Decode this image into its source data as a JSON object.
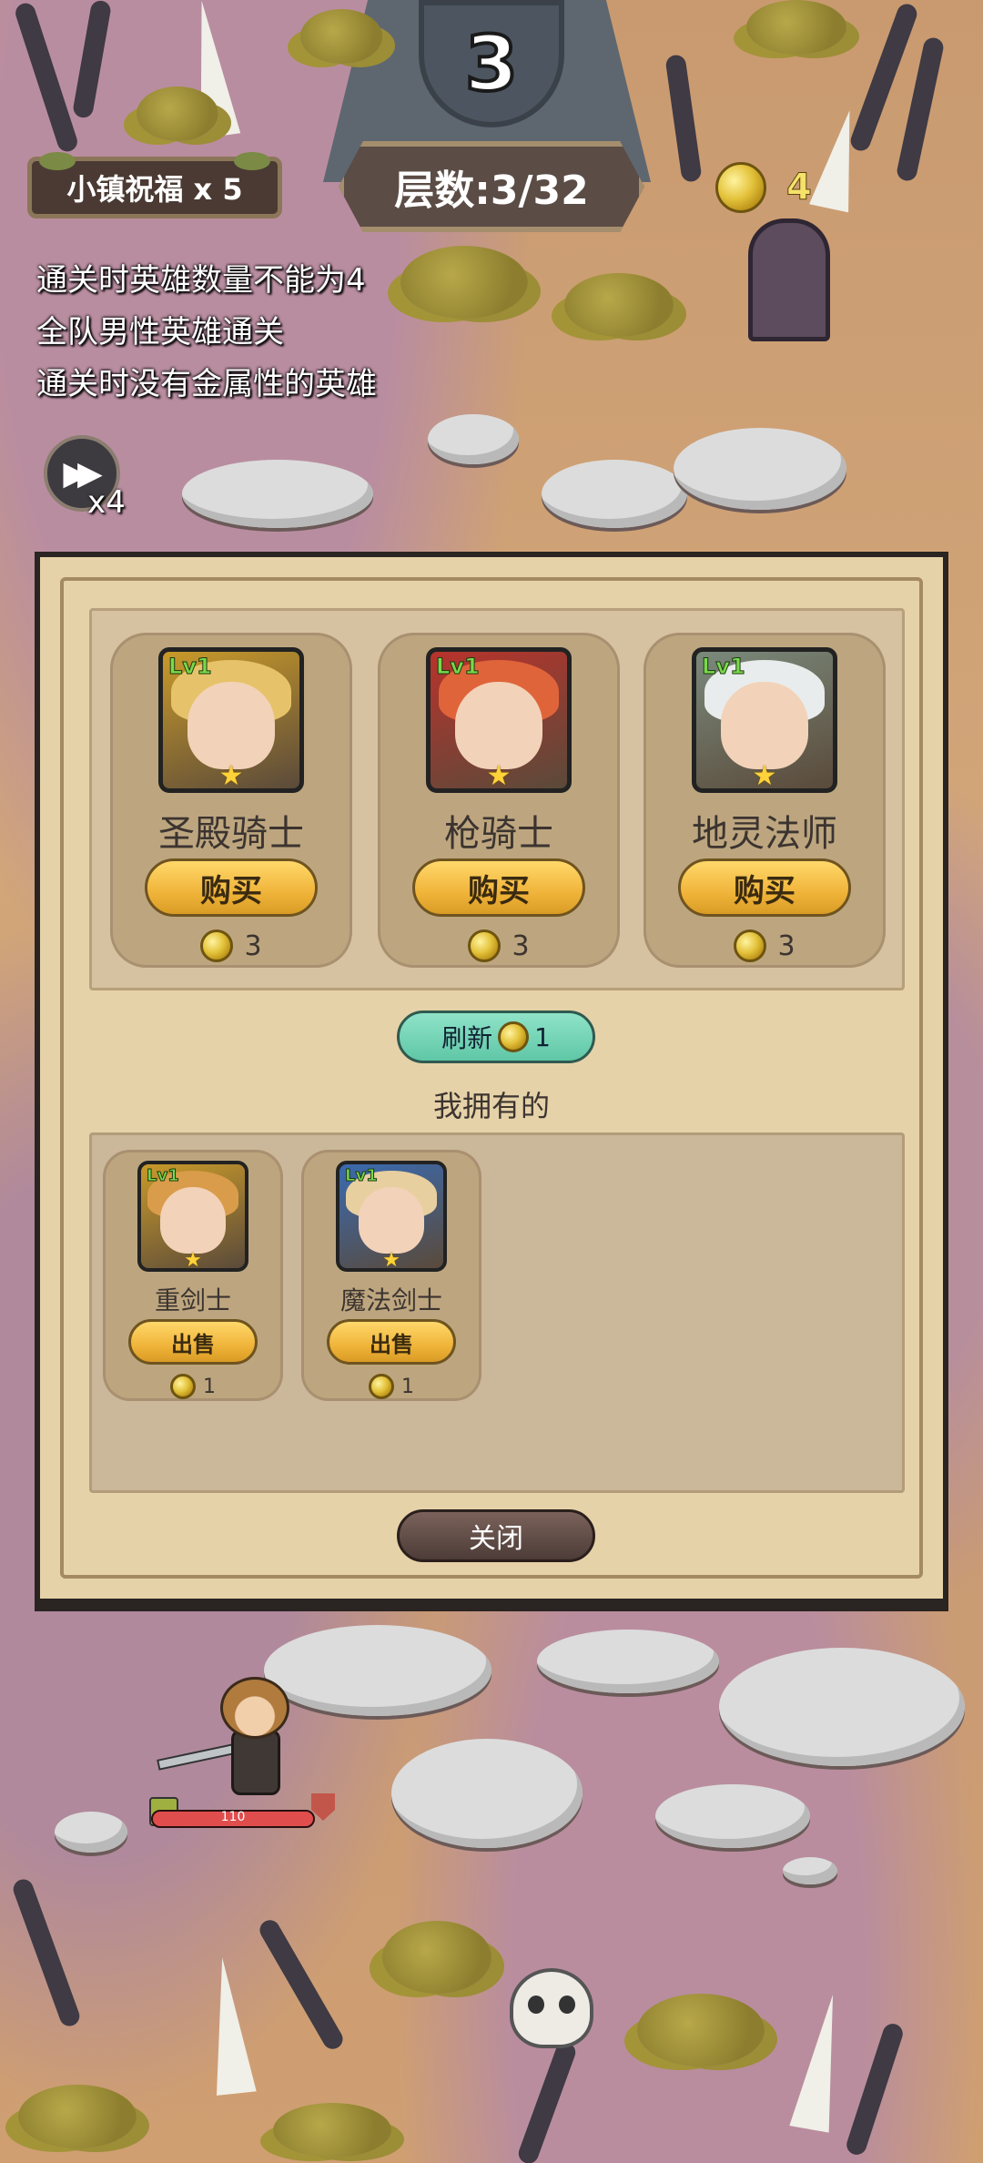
{
  "hud": {
    "wave_number": "3",
    "blessing_label": "小镇祝福 x 5",
    "floor_label": "层数:3/32",
    "coins": "4",
    "speed_label": "x4"
  },
  "quests": [
    "通关时英雄数量不能为4",
    "全队男性英雄通关",
    "通关时没有金属性的英雄"
  ],
  "shop": {
    "cards": [
      {
        "name": "圣殿骑士",
        "level": "Lv1",
        "button": "购买",
        "price": "3",
        "hair_color": "#e6c36a",
        "frame_color": "#c99a2a"
      },
      {
        "name": "枪骑士",
        "level": "Lv1",
        "button": "购买",
        "price": "3",
        "hair_color": "#e0643a",
        "frame_color": "#b8332c"
      },
      {
        "name": "地灵法师",
        "level": "Lv1",
        "button": "购买",
        "price": "3",
        "hair_color": "#e8ecec",
        "frame_color": "#7a8a7c"
      }
    ],
    "refresh_label": "刷新",
    "refresh_price": "1",
    "owned_title": "我拥有的",
    "owned": [
      {
        "name": "重剑士",
        "level": "Lv1",
        "button": "出售",
        "price": "1",
        "hair_color": "#d99c4a",
        "frame_color": "#c99a2a"
      },
      {
        "name": "魔法剑士",
        "level": "Lv1",
        "button": "出售",
        "price": "1",
        "hair_color": "#e8cfa0",
        "frame_color": "#3a6ab0"
      }
    ],
    "close_label": "关闭"
  },
  "player": {
    "hp": "110",
    "hp_fraction": 1.0
  }
}
